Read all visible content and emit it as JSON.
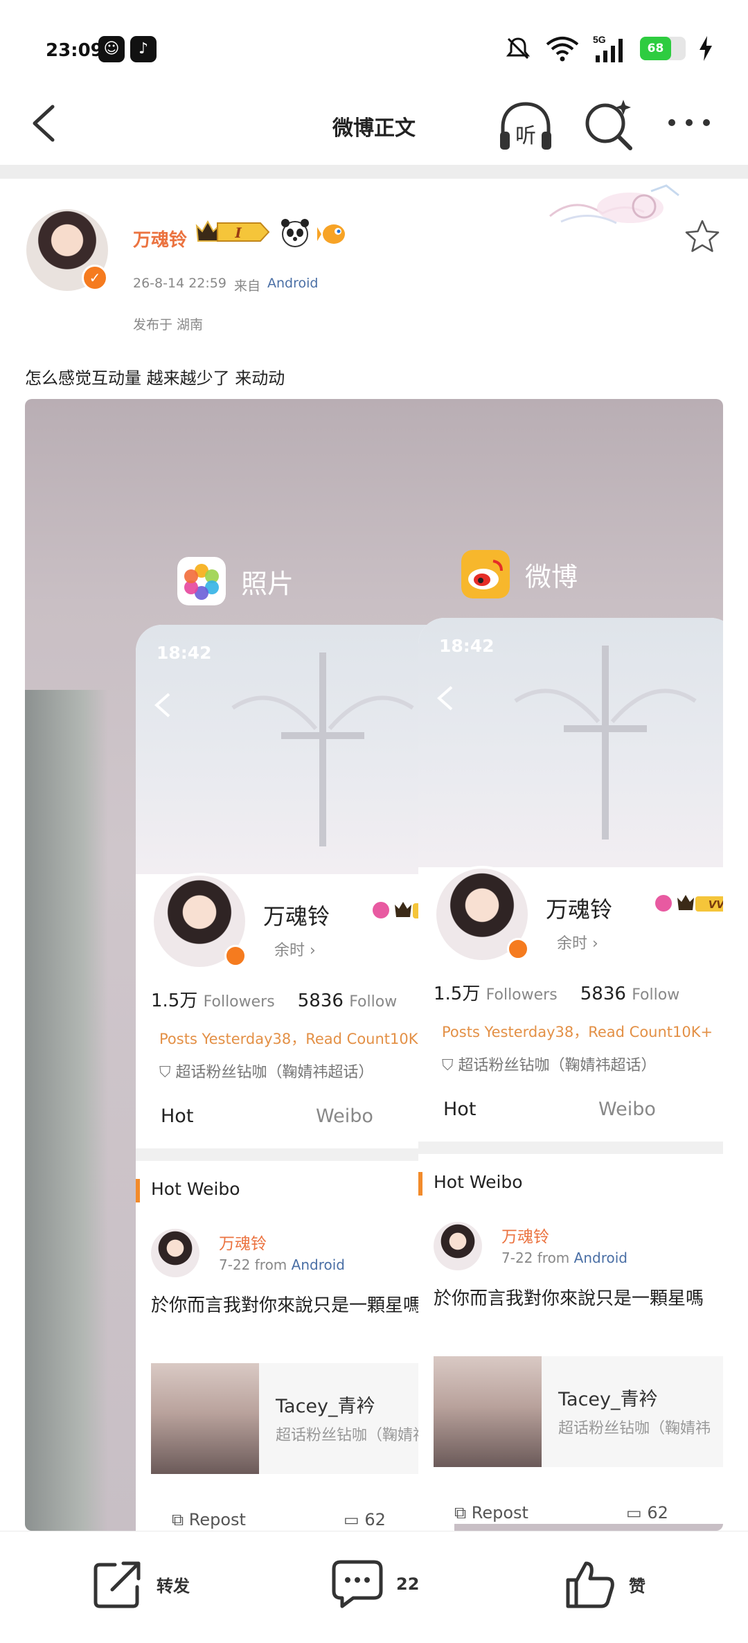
{
  "status_bar": {
    "time": "23:09",
    "battery": "68",
    "network": "5G"
  },
  "nav": {
    "title": "微博正文",
    "listen_label": "听"
  },
  "post": {
    "author": "万魂铃",
    "vip_level": "I",
    "time": "26-8-14 22:59",
    "source_label": "来自",
    "source": "Android",
    "location": "发布于 湖南",
    "text": "怎么感觉互动量 越来越少了 来动动"
  },
  "screenshot": {
    "apps": [
      {
        "name": "照片",
        "icon": "photos-app-icon"
      },
      {
        "name": "微博",
        "icon": "weibo-app-icon"
      }
    ],
    "time": "18:42",
    "profile_name": "万魂铃",
    "vip_badge": "VVIP I",
    "sub_text": "余时 ›",
    "followers_count": "1.5万",
    "followers_label": "Followers",
    "follow_count": "5836",
    "follow_label": "Follow",
    "posts_line_left": "Posts Yesterday38，Read Count10K",
    "posts_line_right": "Posts Yesterday38，Read Count10K+",
    "fan_club": "超话粉丝钻咖（鞠婧祎超话）",
    "tab_hot": "Hot",
    "tab_weibo": "Weibo",
    "hot_title": "Hot Weibo",
    "feed_name": "万魂铃",
    "feed_time": "7-22",
    "feed_from": "from",
    "feed_source": "Android",
    "feed_text": "於你而言我對你來說只是一顆星嗎",
    "repost_name": "Tacey_青衿",
    "repost_sub": "超话粉丝钻咖（鞠婧祎",
    "action_repost": "Repost",
    "action_comments": "62"
  },
  "toolbar": {
    "repost_label": "转发",
    "comment_count": "22",
    "like_label": "赞"
  },
  "colors": {
    "brand_orange": "#eb7340",
    "link_blue": "#4a6fa5",
    "battery_green": "#2ecc40"
  }
}
